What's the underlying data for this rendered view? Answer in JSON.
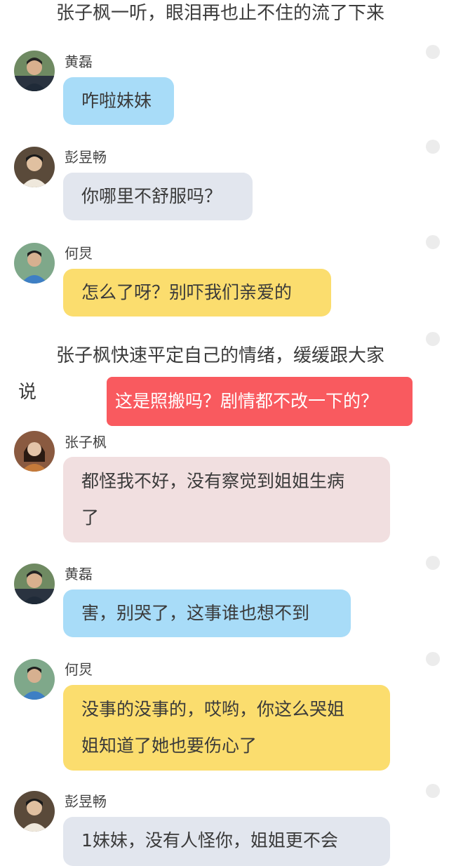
{
  "narration": {
    "line1": "张子枫一听，眼泪再也止不住的流了下来",
    "line2a": "张子枫快速平定自己的情绪，缓缓跟大家",
    "line2b": "说"
  },
  "danmaku": "这是照搬吗？剧情都不改一下的？",
  "messages": [
    {
      "name": "黄磊",
      "text": "咋啦妹妹",
      "color": "#a8dcf8"
    },
    {
      "name": "彭昱畅",
      "text": "你哪里不舒服吗？",
      "color": "#e2e6ee"
    },
    {
      "name": "何炅",
      "text": "怎么了呀？别吓我们亲爱的",
      "color": "#fbdd6e"
    },
    {
      "name": "张子枫",
      "text1": "都怪我不好，没有察觉到姐姐生病",
      "text2": "了",
      "color": "#f1dfe0"
    },
    {
      "name": "黄磊",
      "text": "害，别哭了，这事谁也想不到",
      "color": "#a8dcf8"
    },
    {
      "name": "何炅",
      "text1": "没事的没事的，哎哟，你这么哭姐",
      "text2": "姐知道了她也要伤心了",
      "color": "#fbdd6e"
    },
    {
      "name": "彭昱畅",
      "text": "1妹妹，没有人怪你，姐姐更不会",
      "color": "#e2e6ee"
    }
  ]
}
